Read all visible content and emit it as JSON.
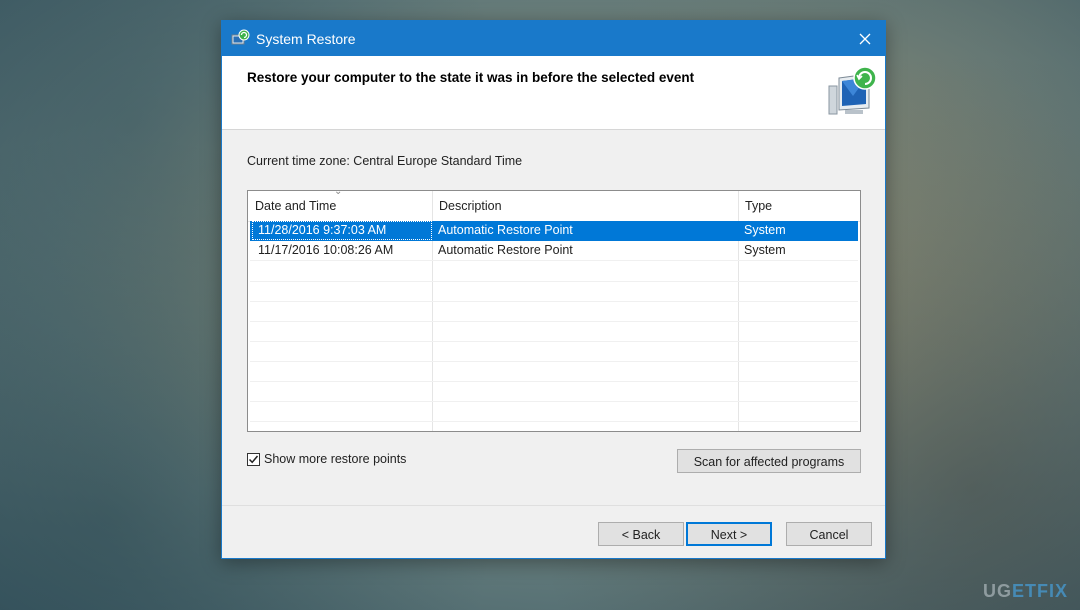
{
  "window": {
    "title": "System Restore",
    "close_icon": "close-icon",
    "app_icon": "system-restore-icon"
  },
  "header": {
    "title": "Restore your computer to the state it was in before the selected event",
    "icon": "restore-monitor-icon"
  },
  "timezone": "Current time zone: Central Europe Standard Time",
  "table": {
    "columns": [
      "Date and Time",
      "Description",
      "Type"
    ],
    "sorted_column": "Date and Time",
    "rows": [
      {
        "date": "11/28/2016 9:37:03 AM",
        "description": "Automatic Restore Point",
        "type": "System",
        "selected": true
      },
      {
        "date": "11/17/2016 10:08:26 AM",
        "description": "Automatic Restore Point",
        "type": "System",
        "selected": false
      }
    ]
  },
  "show_more": {
    "label": "Show more restore points",
    "checked": true
  },
  "buttons": {
    "scan": "Scan for affected programs",
    "back": "< Back",
    "next": "Next >",
    "cancel": "Cancel"
  },
  "watermark": {
    "part1": "UG",
    "part2": "ET",
    "part3": "FIX"
  },
  "colors": {
    "titlebar": "#1979ca",
    "selection": "#0078d7"
  }
}
